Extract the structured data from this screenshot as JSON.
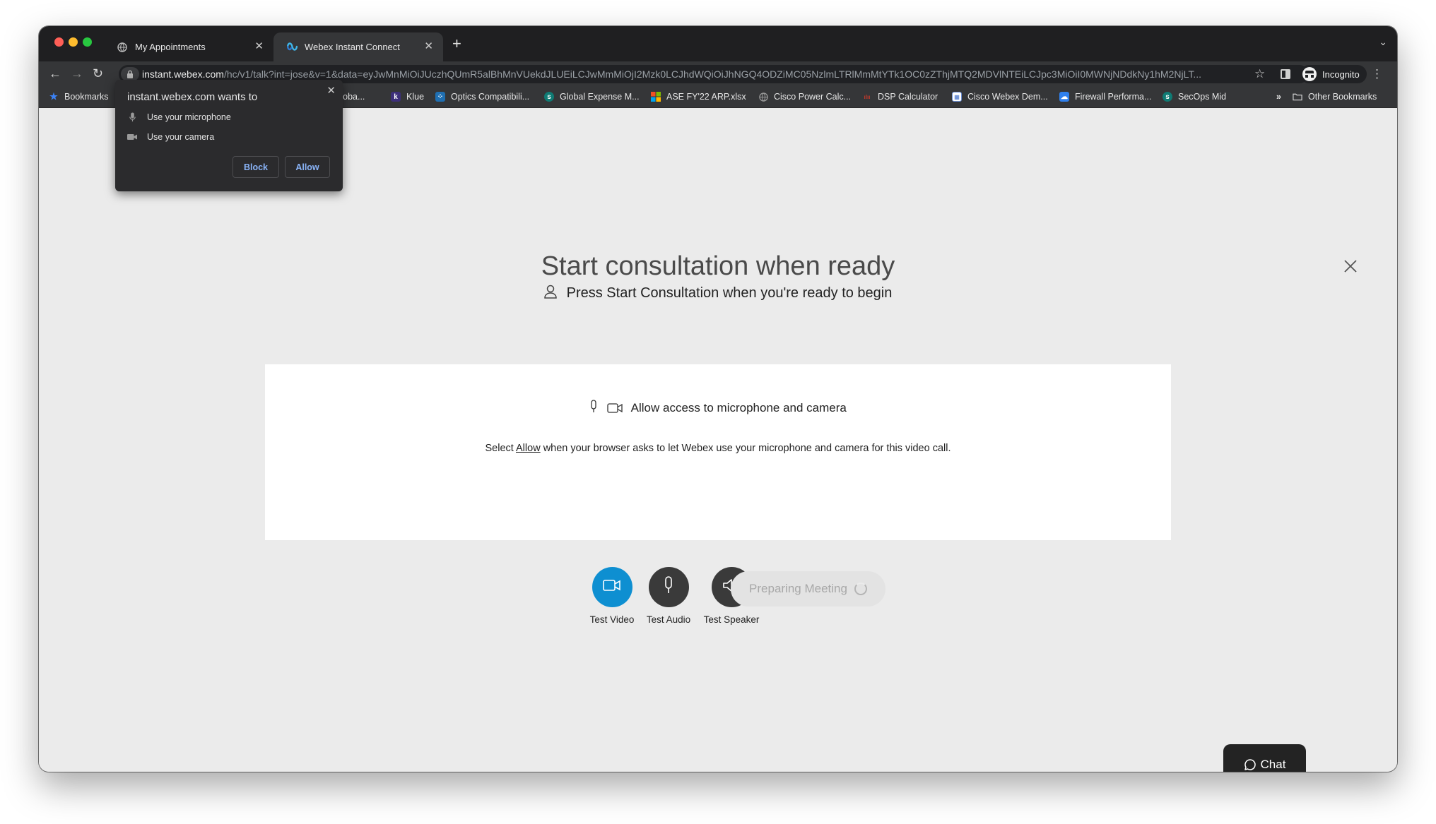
{
  "browser": {
    "tabs": [
      {
        "label": "My Appointments",
        "icon": "globe-icon"
      },
      {
        "label": "Webex Instant Connect",
        "icon": "webex-icon"
      }
    ],
    "new_tab_label": "+",
    "url": {
      "host": "instant.webex.com",
      "path": "/hc/v1/talk?int=jose&v=1&data=eyJwMnMiOiJUczhQUmR5alBhMnVUekdJLUEiLCJwMmMiOjI2Mzk0LCJhdWQiOiJhNGQ4ODZiMC05NzlmLTRlMmMtYTk1OC0zZThjMTQ2MDVlNTEiLCJpc3MiOiI0MWNjNDdkNy1hM2NjLT..."
    },
    "profile_label": "Incognito",
    "bookmarks": [
      {
        "label": "Bookmarks",
        "icon": "star-icon",
        "color": "#3b82f6"
      },
      {
        "label": "- Globa...",
        "icon": "doc-icon",
        "color": "#888888"
      },
      {
        "label": "Klue",
        "icon": "k-icon",
        "color": "#3d2f7a"
      },
      {
        "label": "Optics Compatibili...",
        "icon": "grid-icon",
        "color": "#1f6fb2"
      },
      {
        "label": "Global Expense M...",
        "icon": "sharepoint-icon",
        "color": "#0f7b74"
      },
      {
        "label": "ASE FY'22 ARP.xlsx",
        "icon": "microsoft-icon",
        "color": "#f25022"
      },
      {
        "label": "Cisco Power Calc...",
        "icon": "globe-icon",
        "color": "#777777"
      },
      {
        "label": "DSP Calculator",
        "icon": "cisco-icon",
        "color": "#c0392b"
      },
      {
        "label": "Cisco Webex Dem...",
        "icon": "calendar-icon",
        "color": "#6b8fd6"
      },
      {
        "label": "Firewall Performa...",
        "icon": "cloud-icon",
        "color": "#2f80ed"
      },
      {
        "label": "SecOps Mid",
        "icon": "sharepoint-icon",
        "color": "#0f7b74"
      }
    ],
    "overflow_label": "»",
    "other_bookmarks_label": "Other Bookmarks"
  },
  "permission_popup": {
    "title": "instant.webex.com wants to",
    "items": [
      {
        "label": "Use your microphone",
        "icon": "microphone-icon"
      },
      {
        "label": "Use your camera",
        "icon": "camera-icon"
      }
    ],
    "block_label": "Block",
    "allow_label": "Allow"
  },
  "page": {
    "title": "Start consultation when ready",
    "subtitle": "Press Start Consultation when you're ready to begin",
    "card": {
      "heading": "Allow access to microphone and camera",
      "body_before": "Select ",
      "body_link": "Allow",
      "body_after": " when your browser asks to let Webex use your microphone and camera for this video call."
    },
    "controls": [
      {
        "label": "Test Video",
        "icon": "video-icon",
        "color": "#0e8fd1"
      },
      {
        "label": "Test Audio",
        "icon": "microphone-icon",
        "color": "#3a3a3a"
      },
      {
        "label": "Test Speaker",
        "icon": "speaker-icon",
        "color": "#3a3a3a"
      }
    ],
    "preparing_label": "Preparing Meeting",
    "chat_label": "Chat"
  }
}
